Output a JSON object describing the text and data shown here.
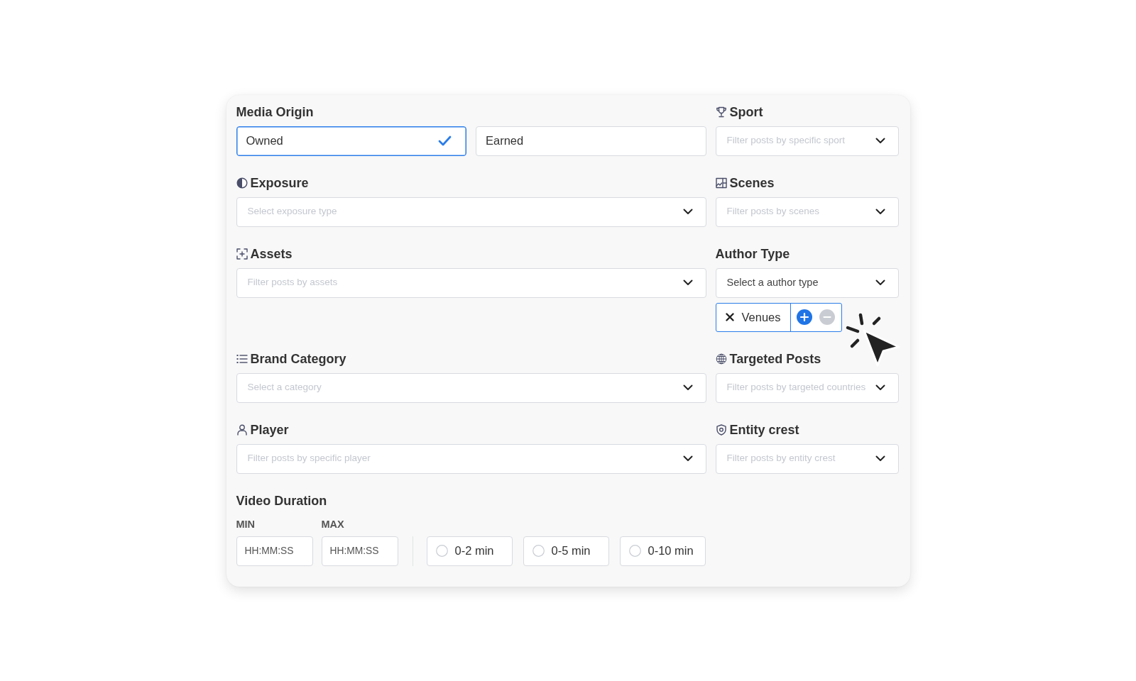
{
  "filters": [
    {
      "kind": "toggle",
      "label": "Media Origin",
      "options": [
        {
          "label": "Owned",
          "selected": true
        },
        {
          "label": "Earned",
          "selected": false
        }
      ]
    },
    {
      "kind": "select",
      "label": "Sport",
      "placeholder": "Filter posts by specific sport"
    },
    {
      "kind": "select",
      "label": "Exposure",
      "placeholder": "Select exposure type"
    },
    {
      "kind": "select",
      "label": "Scenes",
      "placeholder": "Filter posts by scenes"
    },
    {
      "kind": "select",
      "label": "Assets",
      "placeholder": "Filter posts by assets"
    },
    {
      "kind": "select",
      "label": "Author Type",
      "value": "Select a author type",
      "tags": [
        {
          "label": "Venues",
          "actions": [
            {
              "kind": "include",
              "selected": true
            },
            {
              "kind": "exclude",
              "selected": false
            }
          ]
        }
      ]
    },
    {
      "kind": "select",
      "label": "Brand Category",
      "placeholder": "Select a category"
    },
    {
      "kind": "select",
      "label": "Targeted Posts",
      "placeholder": "Filter posts by targeted countries"
    },
    {
      "kind": "select",
      "label": "Player",
      "placeholder": "Filter posts by specific player"
    },
    {
      "kind": "select",
      "label": "Entity crest",
      "placeholder": "Filter posts by entity crest"
    }
  ],
  "video_duration": {
    "label": "Video Duration",
    "min": {
      "label": "MIN",
      "placeholder": "HH:MM:SS"
    },
    "max": {
      "label": "MAX",
      "placeholder": "HH:MM:SS"
    },
    "presets": [
      {
        "label": "0-2 min",
        "selected": false
      },
      {
        "label": "0-5 min",
        "selected": false
      },
      {
        "label": "0-10 min",
        "selected": false
      }
    ]
  }
}
